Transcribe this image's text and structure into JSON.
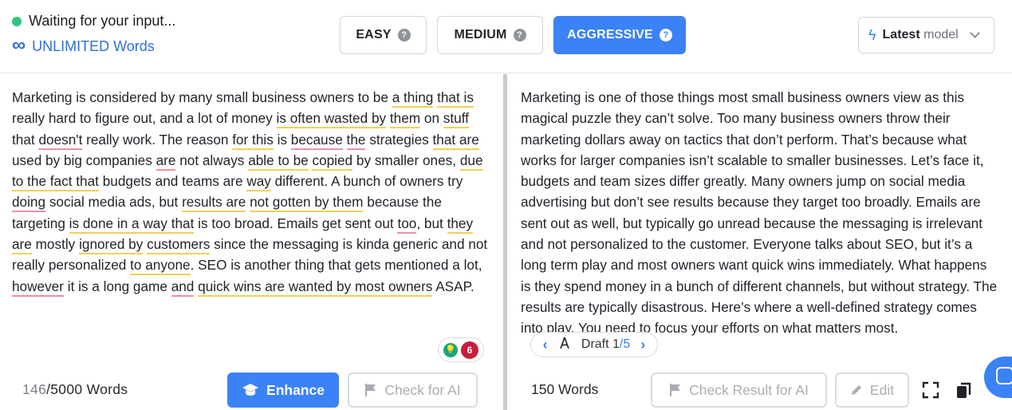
{
  "header": {
    "status_text": "Waiting for your input...",
    "words_limit": "UNLIMITED Words",
    "modes": [
      {
        "label": "EASY",
        "active": false
      },
      {
        "label": "MEDIUM",
        "active": false
      },
      {
        "label": "AGGRESSIVE",
        "active": true
      }
    ],
    "model_bold": "Latest",
    "model_rest": "model"
  },
  "left": {
    "segments": [
      {
        "t": "Marketing is considered by many small business owners to be "
      },
      {
        "t": "a thing",
        "u": "y"
      },
      {
        "t": " "
      },
      {
        "t": "that is",
        "u": "y"
      },
      {
        "t": " really hard to figure out, and a lot of money "
      },
      {
        "t": "is often wasted by",
        "u": "y"
      },
      {
        "t": " "
      },
      {
        "t": "them",
        "u": "y"
      },
      {
        "t": " on "
      },
      {
        "t": "stuff",
        "u": "y"
      },
      {
        "t": " that "
      },
      {
        "t": "doesn't",
        "u": "r"
      },
      {
        "t": " really work. The reason "
      },
      {
        "t": "for this",
        "u": "y"
      },
      {
        "t": " is "
      },
      {
        "t": "because",
        "u": "r"
      },
      {
        "t": " "
      },
      {
        "t": "the",
        "u": "r"
      },
      {
        "t": " strategies "
      },
      {
        "t": "that are",
        "u": "y"
      },
      {
        "t": " used by big companies "
      },
      {
        "t": "are",
        "u": "r"
      },
      {
        "t": " not always "
      },
      {
        "t": "able to be",
        "u": "y"
      },
      {
        "t": " "
      },
      {
        "t": "copied",
        "u": "y"
      },
      {
        "t": " by smaller ones, "
      },
      {
        "t": "due to the fact that",
        "u": "y"
      },
      {
        "t": " budgets and teams are "
      },
      {
        "t": "way",
        "u": "y"
      },
      {
        "t": " different. A bunch of owners try "
      },
      {
        "t": "doing",
        "u": "r"
      },
      {
        "t": " social media ads, but "
      },
      {
        "t": "results are",
        "u": "y"
      },
      {
        "t": " "
      },
      {
        "t": "not gotten by them",
        "u": "y"
      },
      {
        "t": " because the targeting "
      },
      {
        "t": "is done in a way that",
        "u": "y"
      },
      {
        "t": " is too broad. Emails get sent out "
      },
      {
        "t": "too",
        "u": "r"
      },
      {
        "t": ", but "
      },
      {
        "t": "they are",
        "u": "y"
      },
      {
        "t": " mostly "
      },
      {
        "t": "ignored by",
        "u": "y"
      },
      {
        "t": " "
      },
      {
        "t": "customers",
        "u": "y"
      },
      {
        "t": " since the messaging is kinda generic and not really personalized "
      },
      {
        "t": "to anyone",
        "u": "y"
      },
      {
        "t": ". SEO is another thing that gets mentioned a lot, "
      },
      {
        "t": "however",
        "u": "r"
      },
      {
        "t": " it is a long game "
      },
      {
        "t": "and",
        "u": "r"
      },
      {
        "t": " "
      },
      {
        "t": "quick wins are wanted by most owners",
        "u": "y"
      },
      {
        "t": " ASAP."
      }
    ],
    "badge_count": "6",
    "words_used": "146",
    "words_max": "/5000 Words",
    "enhance_label": "Enhance",
    "check_ai_label": "Check for AI"
  },
  "right": {
    "text": "Marketing is one of those things most small business owners view as this magical puzzle they can’t solve. Too many business owners throw their marketing dollars away on tactics that don’t perform. That’s because what works for larger companies isn’t scalable to smaller businesses. Let’s face it, budgets and team sizes differ greatly. Many owners jump on social media advertising but don’t see results because they target too broadly. Emails are sent out as well, but typically go unread because the messaging is irrelevant and not personalized to the customer. Everyone talks about SEO, but it’s a long term play and most owners want quick wins immediately. What happens is they spend money in a bunch of different channels, but without strategy. The results are typically disastrous. Here’s where a well-defined strategy comes into play. You need to focus your efforts on what matters most.",
    "draft_label": "Draft",
    "draft_current": "1",
    "draft_total": "/5",
    "word_count": "150 Words",
    "check_result_label": "Check Result for AI",
    "edit_label": "Edit"
  },
  "colors": {
    "accent": "#3b82f6",
    "status_green": "#2fc47a",
    "underline_yellow": "#f2cf5a",
    "underline_red": "#ee8fa4"
  }
}
